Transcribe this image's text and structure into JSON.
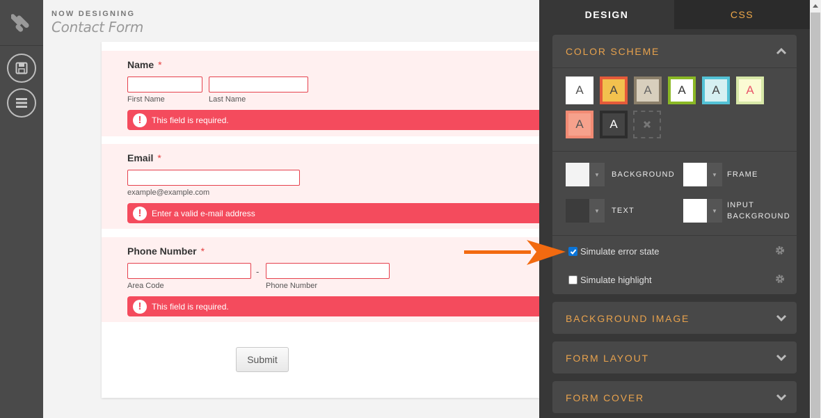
{
  "header": {
    "now_designing": "NOW DESIGNING",
    "form_title": "Contact Form"
  },
  "form": {
    "name": {
      "label": "Name",
      "required": "*",
      "first_sub": "First Name",
      "last_sub": "Last Name",
      "error": "This field is required."
    },
    "email": {
      "label": "Email",
      "required": "*",
      "sub": "example@example.com",
      "error": "Enter a valid e-mail address"
    },
    "phone": {
      "label": "Phone Number",
      "required": "*",
      "dash": "-",
      "area_sub": "Area Code",
      "number_sub": "Phone Number",
      "error": "This field is required."
    },
    "submit_label": "Submit"
  },
  "panel": {
    "tabs": {
      "design": "DESIGN",
      "css": "CSS"
    },
    "color_scheme": {
      "title": "COLOR SCHEME",
      "swatch_letter": "A",
      "swatches": [
        {
          "bg": "#ffffff",
          "border": "#ffffff",
          "fg": "#555555"
        },
        {
          "bg": "#f2c14e",
          "border": "#e55a3a",
          "fg": "#444444"
        },
        {
          "bg": "#d8cfbd",
          "border": "#8b7f6a",
          "fg": "#666666"
        },
        {
          "bg": "#ffffff",
          "border": "#8ab825",
          "fg": "#333333"
        },
        {
          "bg": "#d6f0f2",
          "border": "#53c2d6",
          "fg": "#444444"
        },
        {
          "bg": "#fbfbd4",
          "border": "#d8e8a8",
          "fg": "#e9566a"
        },
        {
          "bg": "#f6a18c",
          "border": "#f28b74",
          "fg": "#555555"
        },
        {
          "bg": "#444444",
          "border": "#2d2d2d",
          "fg": "#ffffff"
        }
      ],
      "controls": {
        "background": "BACKGROUND",
        "frame": "FRAME",
        "text": "TEXT",
        "input_background": "INPUT BACKGROUND"
      },
      "simulate_error": "Simulate error state",
      "simulate_error_checked": true,
      "simulate_highlight": "Simulate highlight",
      "simulate_highlight_checked": false
    },
    "sections": {
      "background_image": "BACKGROUND IMAGE",
      "form_layout": "FORM LAYOUT",
      "form_cover": "FORM COVER"
    }
  },
  "colors": {
    "accent": "#e8a24d",
    "error": "#f44b5d",
    "annotation_arrow": "#f26a10"
  }
}
